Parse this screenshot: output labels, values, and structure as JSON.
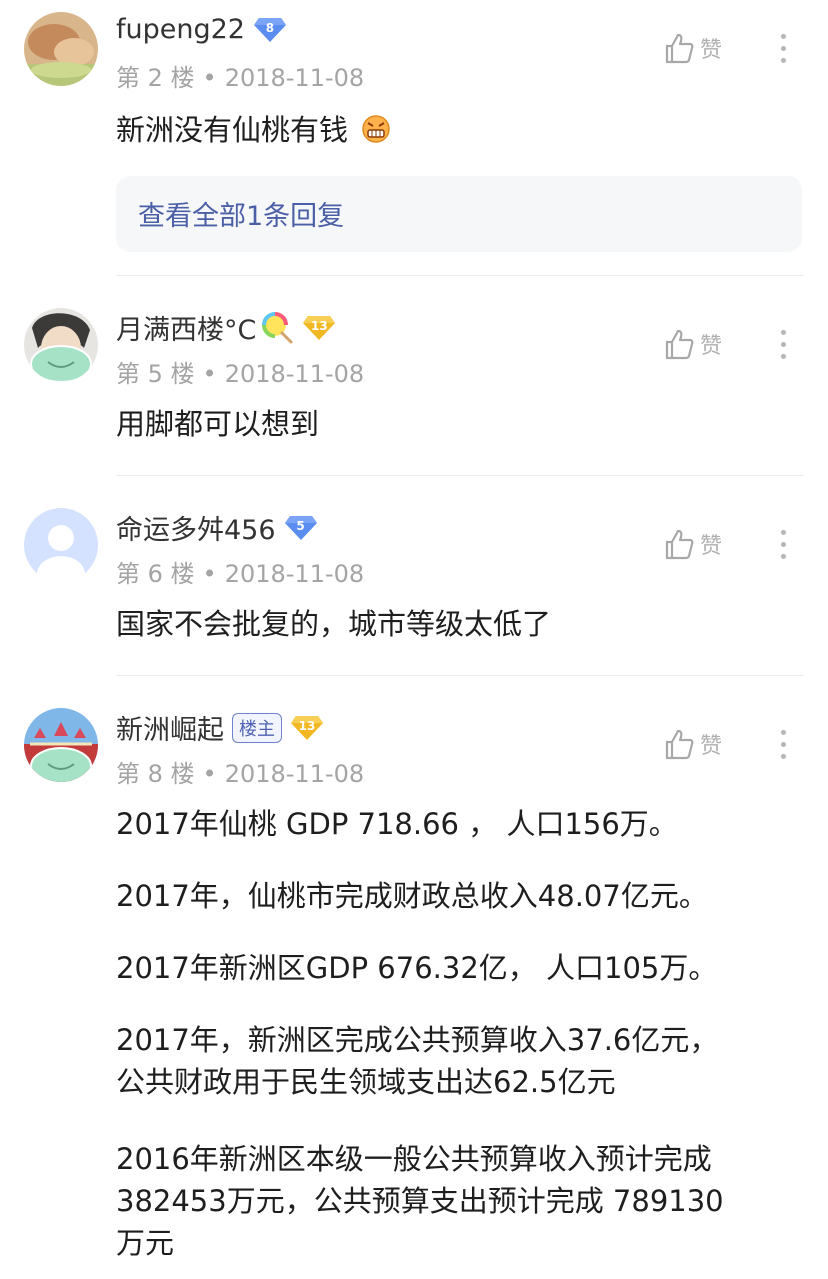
{
  "comments": [
    {
      "username": "fupeng22",
      "level": "8",
      "floor": "第 2 楼",
      "dot": "•",
      "date": "2018-11-08",
      "like_label": "赞",
      "content": "新洲没有仙桃有钱",
      "emoji": "grimacing-face-icon",
      "reply_link": "查看全部1条回复"
    },
    {
      "username": "月满西楼°C",
      "level": "13",
      "floor": "第 5 楼",
      "dot": "•",
      "date": "2018-11-08",
      "like_label": "赞",
      "content": "用脚都可以想到"
    },
    {
      "username": "命运多舛456",
      "level": "5",
      "floor": "第 6 楼",
      "dot": "•",
      "date": "2018-11-08",
      "like_label": "赞",
      "content": "国家不会批复的，城市等级太低了"
    },
    {
      "username": "新洲崛起",
      "owner_tag": "楼主",
      "level": "13",
      "floor": "第 8 楼",
      "dot": "•",
      "date": "2018-11-08",
      "like_label": "赞",
      "paragraphs": [
        "2017年仙桃 GDP 718.66 ， 人口156万。",
        "2017年，仙桃市完成财政总收入48.07亿元。",
        "2017年新洲区GDP 676.32亿， 人口105万。",
        "2017年，新洲区完成公共预算收入37.6亿元，",
        "公共财政用于民生领域支出达62.5亿元",
        "2016年新洲区本级一般公共预算收入预计完成",
        "382453万元，公共预算支出预计完成 789130",
        "万元"
      ]
    }
  ],
  "colors": {
    "badge_blue": "#5b8cf0",
    "badge_gold": "#f2b824",
    "link": "#4b5fa6",
    "meta": "#a4a4a4"
  }
}
